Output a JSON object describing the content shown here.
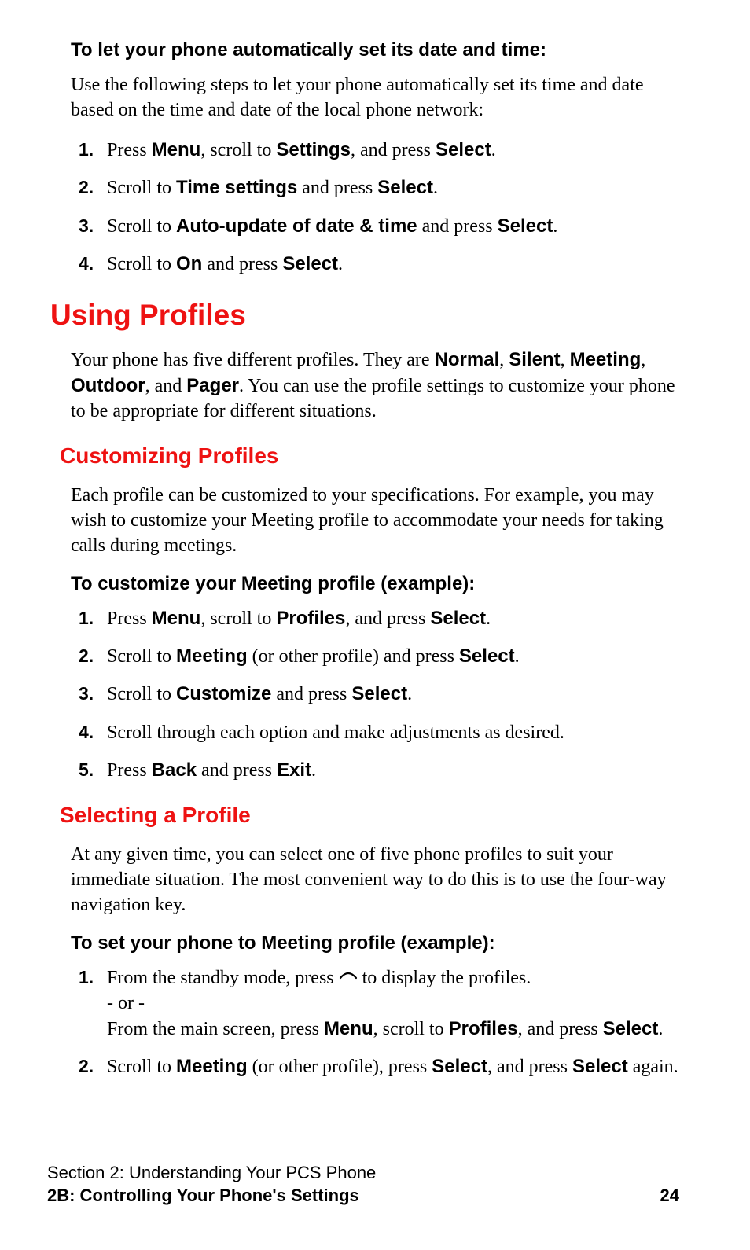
{
  "autoDate": {
    "heading": "To let your phone automatically set its date and time:",
    "intro": "Use the following steps to let your phone automatically set its time and date based on the time and date of the local phone network:",
    "steps": {
      "s1": {
        "pre": "Press ",
        "b1": "Menu",
        "mid1": ", scroll to ",
        "b2": "Settings",
        "mid2": ", and press ",
        "b3": "Select",
        "post": "."
      },
      "s2": {
        "pre": "Scroll to ",
        "b1": "Time settings",
        "mid1": " and press ",
        "b2": "Select",
        "post": "."
      },
      "s3": {
        "pre": "Scroll to ",
        "b1": "Auto-update of date & time",
        "mid1": " and press ",
        "b2": "Select",
        "post": "."
      },
      "s4": {
        "pre": "Scroll to ",
        "b1": "On",
        "mid1": " and press ",
        "b2": "Select",
        "post": "."
      }
    }
  },
  "profiles": {
    "h1": "Using Profiles",
    "intro": {
      "t1": "Your phone has five different profiles. They are ",
      "b1": "Normal",
      "t2": ", ",
      "b2": "Silent",
      "t3": ", ",
      "b3": "Meeting",
      "t4": ", ",
      "b4": "Outdoor",
      "t5": ", and ",
      "b5": "Pager",
      "t6": ". You can use the profile settings to customize your phone to be appropriate for different situations."
    }
  },
  "customizing": {
    "h2": "Customizing Profiles",
    "intro": "Each profile can be customized to your specifications. For example, you may wish to customize your Meeting profile to accommodate your needs for taking calls during meetings.",
    "lead": "To customize your Meeting profile (example):",
    "steps": {
      "s1": {
        "pre": "Press ",
        "b1": "Menu",
        "mid1": ", scroll to ",
        "b2": "Profiles",
        "mid2": ", and press ",
        "b3": "Select",
        "post": "."
      },
      "s2": {
        "pre": "Scroll to ",
        "b1": "Meeting",
        "mid1": " (or other profile) and press ",
        "b2": "Select",
        "post": "."
      },
      "s3": {
        "pre": "Scroll to ",
        "b1": "Customize",
        "mid1": " and press ",
        "b2": "Select",
        "post": "."
      },
      "s4": {
        "text": "Scroll through each option and make adjustments as desired."
      },
      "s5": {
        "pre": "Press ",
        "b1": "Back",
        "mid1": " and press ",
        "b2": "Exit",
        "post": "."
      }
    }
  },
  "selecting": {
    "h2": "Selecting a Profile",
    "intro": "At any given time, you can select one of five phone profiles to suit your immediate situation. The most convenient way to do this is to use the four-way navigation key.",
    "lead": "To set your phone to Meeting profile (example):",
    "steps": {
      "s1": {
        "pre": "From the standby mode, press ",
        "post": " to display the profiles.",
        "or": "- or -",
        "alt_pre": "From the main screen, press ",
        "alt_b1": "Menu",
        "alt_mid1": ", scroll to ",
        "alt_b2": "Profiles",
        "alt_mid2": ", and press ",
        "alt_b3": "Select",
        "alt_post": "."
      },
      "s2": {
        "pre": "Scroll to ",
        "b1": "Meeting",
        "mid1": " (or other profile), press ",
        "b2": "Select",
        "mid2": ", and press ",
        "b3": "Select",
        "post": " again."
      }
    }
  },
  "footer": {
    "line1": "Section 2: Understanding Your PCS Phone",
    "line2": "2B: Controlling Your Phone's Settings",
    "pageNum": "24"
  },
  "nums": {
    "n1": "1.",
    "n2": "2.",
    "n3": "3.",
    "n4": "4.",
    "n5": "5."
  }
}
